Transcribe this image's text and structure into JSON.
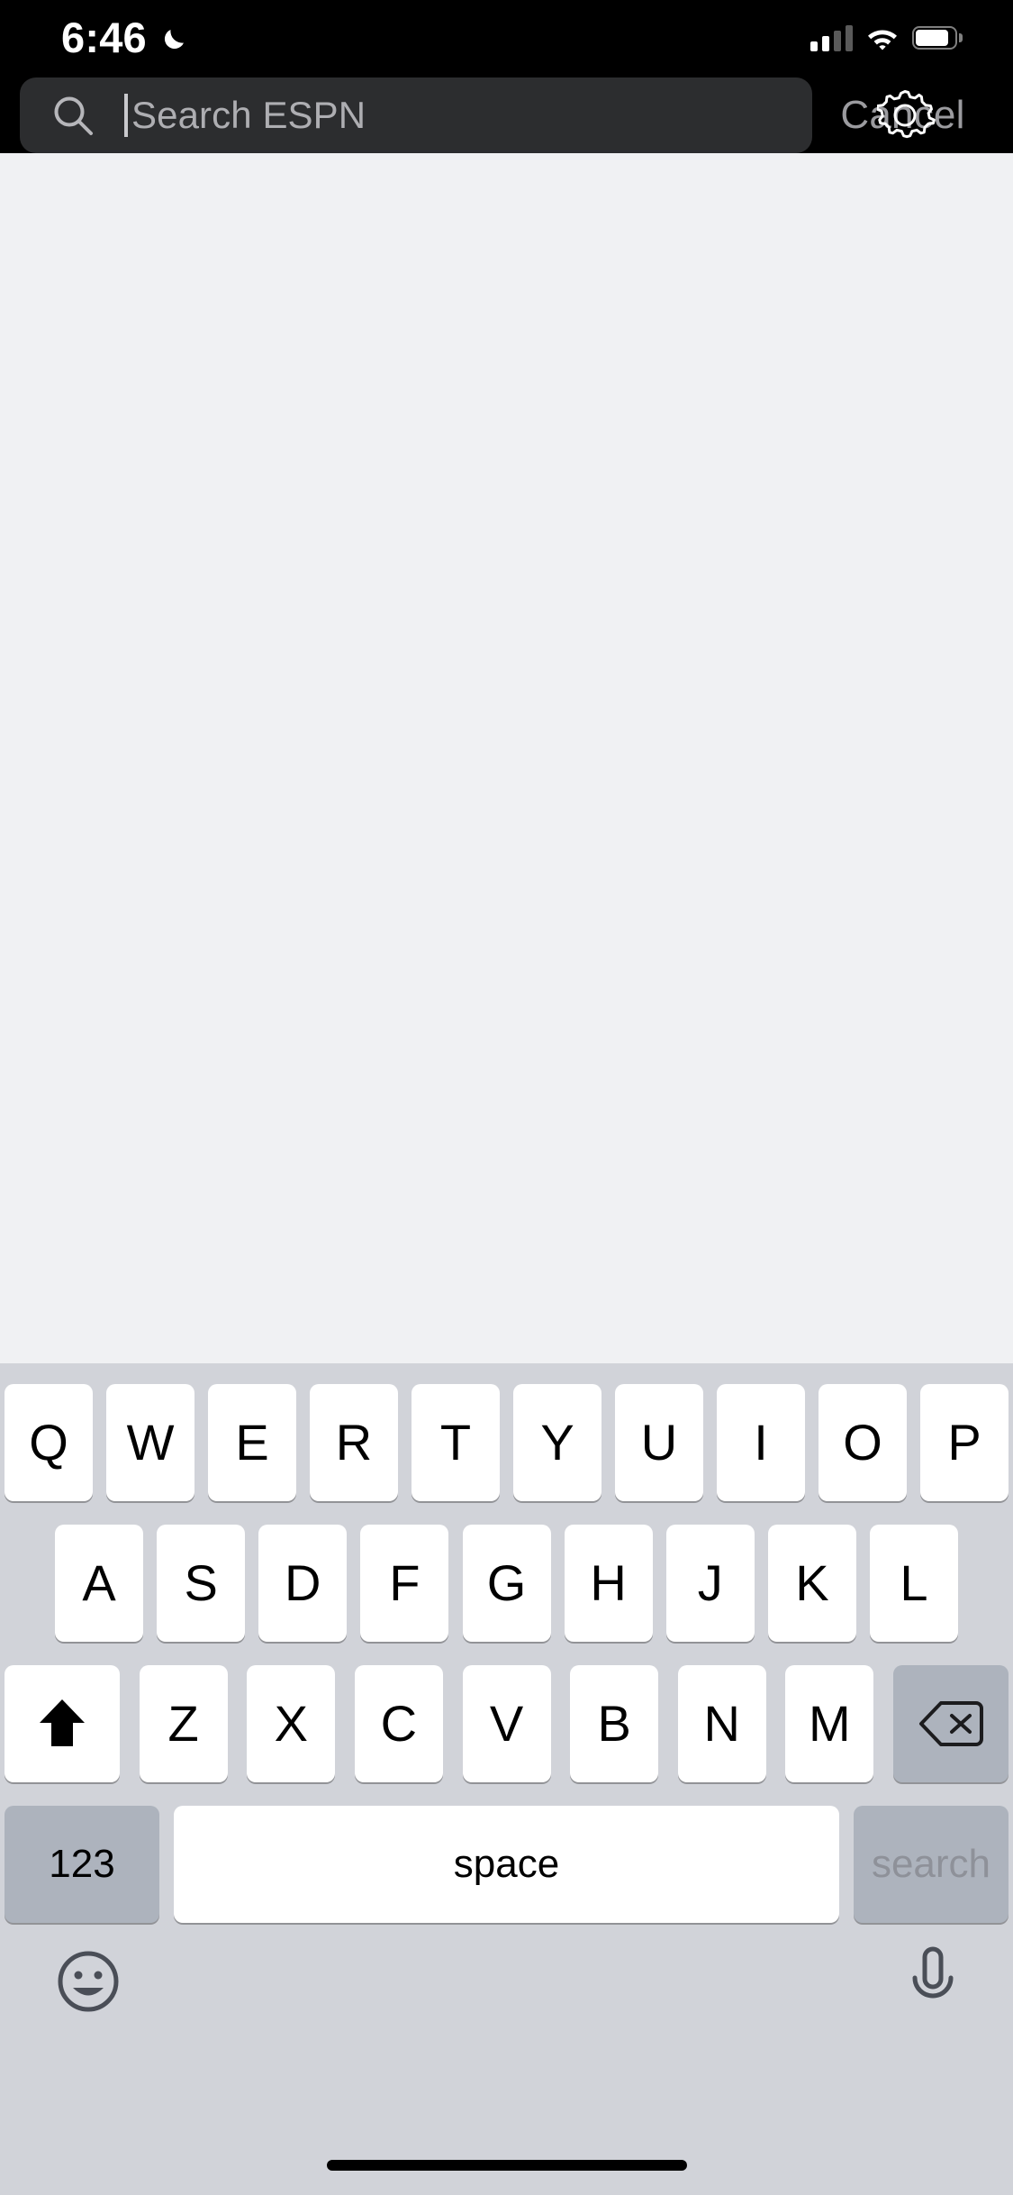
{
  "status_bar": {
    "time": "6:46",
    "moon_icon": "crescent-moon-icon",
    "do_not_disturb": true,
    "signal_icon": "cellular-signal-icon",
    "signal_bars_filled": 2,
    "signal_bars_total": 4,
    "wifi_icon": "wifi-icon",
    "battery_icon": "battery-icon",
    "battery_level_percent": 80
  },
  "search_header": {
    "search_icon": "search-magnifier-icon",
    "placeholder": "Search ESPN",
    "value": "",
    "caret_visible": true,
    "cancel_label": "Cancel",
    "gear_icon": "gear-settings-icon",
    "field_background": "#2c2d2f",
    "header_background": "#000000",
    "placeholder_color": "#aeaeb2",
    "cancel_color": "#9b9b9f"
  },
  "content": {
    "background": "#f0f1f3",
    "results": []
  },
  "keyboard": {
    "type": "qwerty",
    "layout": "uppercase",
    "background": "#d1d3d9",
    "key_background": "#ffffff",
    "modifier_background": "#adb3bd",
    "rows": [
      [
        "Q",
        "W",
        "E",
        "R",
        "T",
        "Y",
        "U",
        "I",
        "O",
        "P"
      ],
      [
        "A",
        "S",
        "D",
        "F",
        "G",
        "H",
        "J",
        "K",
        "L"
      ],
      [
        "Z",
        "X",
        "C",
        "V",
        "B",
        "N",
        "M"
      ]
    ],
    "shift_key": {
      "icon": "shift-arrow-icon",
      "active": true
    },
    "backspace_key": {
      "icon": "backspace-delete-icon"
    },
    "numbers_key_label": "123",
    "space_key_label": "space",
    "return_key_label": "search",
    "return_key_enabled": false,
    "emoji_key_icon": "emoji-smiley-icon",
    "dictation_key_icon": "microphone-icon"
  },
  "home_indicator": {
    "visible": true,
    "color": "#000000"
  }
}
